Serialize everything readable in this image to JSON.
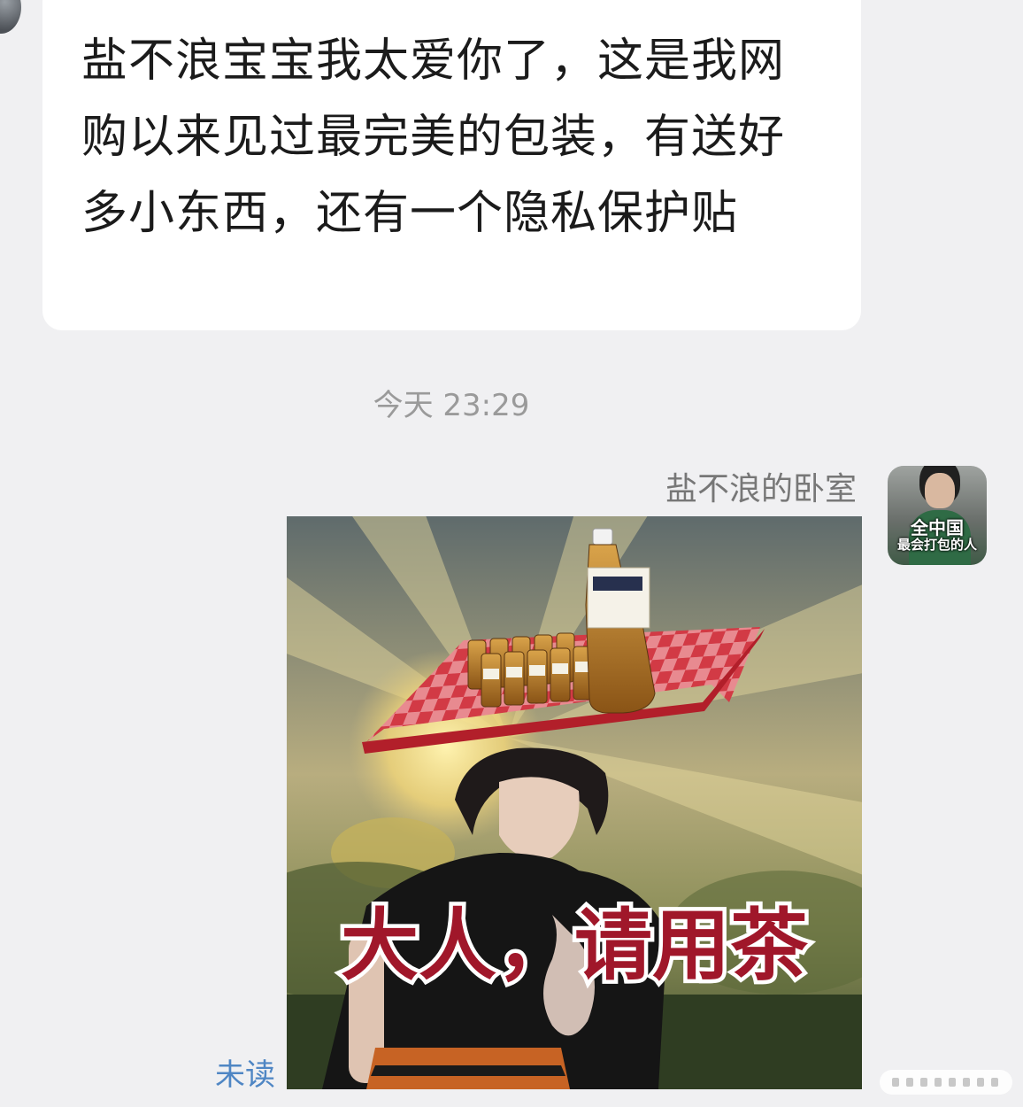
{
  "chat": {
    "incoming_message": {
      "text": "盐不浪宝宝我太爱你了，这是我网购以来见过最完美的包装，有送好多小东西，还有一个隐私保护贴"
    },
    "timestamp": "今天 23:29",
    "outgoing_message": {
      "sender_name": "盐不浪的卧室",
      "avatar_caption_line1": "全中国",
      "avatar_caption_line2": "最会打包的人",
      "sticker_caption": "大人，请用茶",
      "read_status": "未读"
    }
  },
  "colors": {
    "background": "#f0f0f2",
    "bubble": "#ffffff",
    "unread_link": "#4f86c4",
    "timestamp_text": "#9a9a9a",
    "sticker_caption_fill": "#a0172a",
    "tablecloth_red": "#d23a45"
  }
}
